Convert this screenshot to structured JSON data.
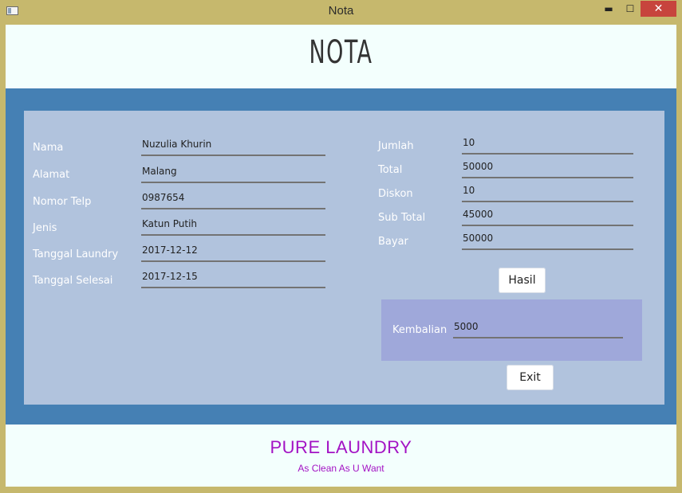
{
  "window": {
    "title": "Nota",
    "minimize": "▬",
    "maximize": "☐",
    "close": "✕"
  },
  "header": {
    "title": "NOTA"
  },
  "form_left": [
    {
      "label": "Nama",
      "value": "Nuzulia Khurin"
    },
    {
      "label": "Alamat",
      "value": "Malang"
    },
    {
      "label": "Nomor Telp",
      "value": "0987654"
    },
    {
      "label": "Jenis",
      "value": "Katun Putih"
    },
    {
      "label": "Tanggal Laundry",
      "value": "2017-12-12"
    },
    {
      "label": "Tanggal Selesai",
      "value": "2017-12-15"
    }
  ],
  "form_right": [
    {
      "label": "Jumlah",
      "value": "10"
    },
    {
      "label": "Total",
      "value": "50000"
    },
    {
      "label": "Diskon",
      "value": "10"
    },
    {
      "label": "Sub Total",
      "value": "45000"
    },
    {
      "label": "Bayar",
      "value": "50000"
    }
  ],
  "buttons": {
    "hasil": "Hasil",
    "exit": "Exit"
  },
  "change": {
    "label": "Kembalian",
    "value": "5000"
  },
  "footer": {
    "brand": "PURE LAUNDRY",
    "tagline": "As Clean As U Want"
  },
  "colors": {
    "titlebar": "#c6b86d",
    "frame": "#4580b4",
    "panel": "#b1c3dd",
    "change_box": "#9fa8da",
    "brand": "#a312c4",
    "header_bg": "#f3fffd"
  }
}
